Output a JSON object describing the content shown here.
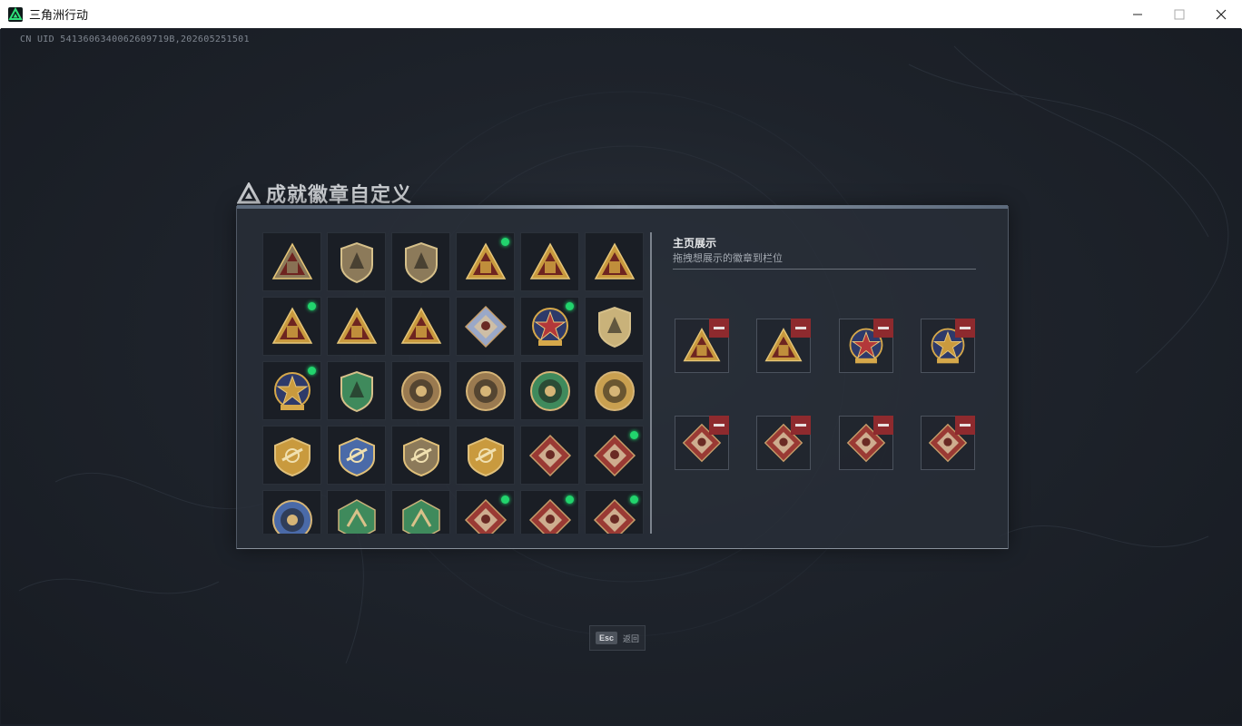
{
  "window": {
    "title": "三角洲行动",
    "icons": [
      "app-logo-icon",
      "minimize-icon",
      "maximize-icon",
      "close-icon"
    ]
  },
  "overlay": {
    "uid_text": "CN UID 5413606340062609719B,202605251501"
  },
  "panel": {
    "title": "成就徽章自定义",
    "showcase": {
      "title": "主页展示",
      "subtitle": "拖拽想展示的徽章到栏位"
    },
    "badges": [
      {
        "icon": "shield-triangle-badge-icon",
        "new": false,
        "color": "#8c7a5a"
      },
      {
        "icon": "helicopter-badge-icon",
        "new": false,
        "color": "#8c7a5a"
      },
      {
        "icon": "arrow-shield-badge-icon",
        "new": false,
        "color": "#8c7a5a"
      },
      {
        "icon": "backpack-triangle-badge-icon",
        "new": true,
        "color": "#c99a3e"
      },
      {
        "icon": "sb-triangle-badge-icon",
        "new": false,
        "color": "#c99a3e"
      },
      {
        "icon": "tower-triangle-badge-icon",
        "new": false,
        "color": "#c99a3e"
      },
      {
        "icon": "number-one-triangle-badge-icon",
        "new": true,
        "color": "#c99a3e"
      },
      {
        "icon": "crate-triangle-badge-icon",
        "new": false,
        "color": "#c99a3e"
      },
      {
        "icon": "soldiers-triangle-badge-icon",
        "new": false,
        "color": "#c99a3e"
      },
      {
        "icon": "diamond-cube-badge-icon",
        "new": false,
        "color": "#9aa8c8"
      },
      {
        "icon": "star-medal-badge-icon",
        "new": true,
        "color": "#b3383a"
      },
      {
        "icon": "hand-shield-badge-icon",
        "new": false,
        "color": "#c9b27a"
      },
      {
        "icon": "stars-crest-badge-icon",
        "new": true,
        "color": "#c99a3e"
      },
      {
        "icon": "green-shield-badge-icon",
        "new": false,
        "color": "#3f8a5c"
      },
      {
        "icon": "round-target-badge-icon",
        "new": false,
        "color": "#9a7a50"
      },
      {
        "icon": "crosshair-skull-badge-icon",
        "new": false,
        "color": "#9a7a50"
      },
      {
        "icon": "green-emblem-badge-icon",
        "new": false,
        "color": "#3f8a5c"
      },
      {
        "icon": "sunburst-badge-icon",
        "new": false,
        "color": "#c9a050"
      },
      {
        "icon": "winged-shield-gold-badge-icon",
        "new": false,
        "color": "#c99a3e"
      },
      {
        "icon": "winged-shield-blue-badge-icon",
        "new": false,
        "color": "#4a6aa8"
      },
      {
        "icon": "rifle-shield-badge-icon",
        "new": false,
        "color": "#8c7a5a"
      },
      {
        "icon": "winged-shield-gold2-badge-icon",
        "new": false,
        "color": "#c99a3e"
      },
      {
        "icon": "beast-diamond-badge-icon",
        "new": false,
        "color": "#9a3a34"
      },
      {
        "icon": "beast-diamond2-badge-icon",
        "new": true,
        "color": "#9a3a34"
      },
      {
        "icon": "wolf-circle-badge-icon",
        "new": false,
        "color": "#4a6aa8"
      },
      {
        "icon": "hornet-hex-badge-icon",
        "new": false,
        "color": "#3f8a5c"
      },
      {
        "icon": "soldier-hex-badge-icon",
        "new": false,
        "color": "#3f8a5c"
      },
      {
        "icon": "beast-diamond3-badge-icon",
        "new": true,
        "color": "#9a3a34"
      },
      {
        "icon": "beast-diamond4-badge-icon",
        "new": true,
        "color": "#9a3a34"
      },
      {
        "icon": "runner-diamond-badge-icon",
        "new": true,
        "color": "#9a3a34"
      }
    ],
    "slots": [
      {
        "icon": "backpack-triangle-badge-icon",
        "color": "#c99a3e"
      },
      {
        "icon": "number-one-triangle-badge-icon",
        "color": "#c99a3e"
      },
      {
        "icon": "star-medal-badge-icon",
        "color": "#b3383a"
      },
      {
        "icon": "stars-crest-badge-icon",
        "color": "#c99a3e"
      },
      {
        "icon": "beast-diamond-badge-icon",
        "color": "#9a3a34"
      },
      {
        "icon": "runner-diamond-badge-icon",
        "color": "#9a3a34"
      },
      {
        "icon": "beast-diamond3-badge-icon",
        "color": "#9a3a34"
      },
      {
        "icon": "beast-diamond4-badge-icon",
        "color": "#9a3a34"
      }
    ]
  },
  "footer": {
    "esc_key": "Esc",
    "esc_label": "返回"
  },
  "colors": {
    "new_indicator": "#22d46d",
    "remove_button": "#8e2a2e"
  }
}
